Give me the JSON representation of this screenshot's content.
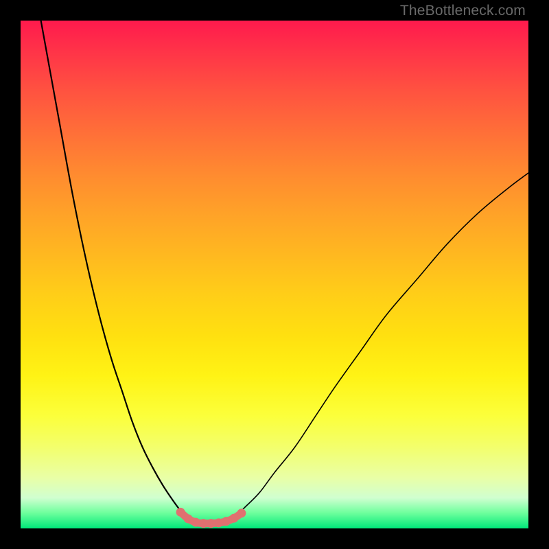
{
  "watermark": "TheBottleneck.com",
  "chart_data": {
    "type": "line",
    "title": "",
    "xlabel": "",
    "ylabel": "",
    "xlim": [
      0,
      100
    ],
    "ylim": [
      0,
      100
    ],
    "grid": false,
    "legend": false,
    "series": [
      {
        "name": "left-curve",
        "x": [
          4,
          6,
          8,
          10,
          12,
          14,
          16,
          18,
          20,
          22,
          24,
          26,
          28,
          30,
          31.5,
          33
        ],
        "y": [
          100,
          89,
          78,
          67,
          57,
          48,
          40,
          33,
          27,
          21,
          16,
          12,
          8.5,
          5.5,
          3.5,
          2
        ]
      },
      {
        "name": "right-curve",
        "x": [
          42,
          44,
          47,
          50,
          54,
          58,
          62,
          67,
          72,
          78,
          84,
          90,
          96,
          100
        ],
        "y": [
          2,
          4,
          7,
          11,
          16,
          22,
          28,
          35,
          42,
          49,
          56,
          62,
          67,
          70
        ]
      },
      {
        "name": "valley-marker",
        "x": [
          31.5,
          33,
          34.5,
          36,
          37.5,
          39,
          40.5,
          42,
          43.5
        ],
        "y": [
          3.2,
          1.9,
          1.2,
          1.0,
          1.0,
          1.1,
          1.4,
          2.0,
          3.0
        ]
      }
    ],
    "annotations": [
      {
        "text": "TheBottleneck.com",
        "role": "watermark",
        "position": "top-right"
      }
    ]
  }
}
